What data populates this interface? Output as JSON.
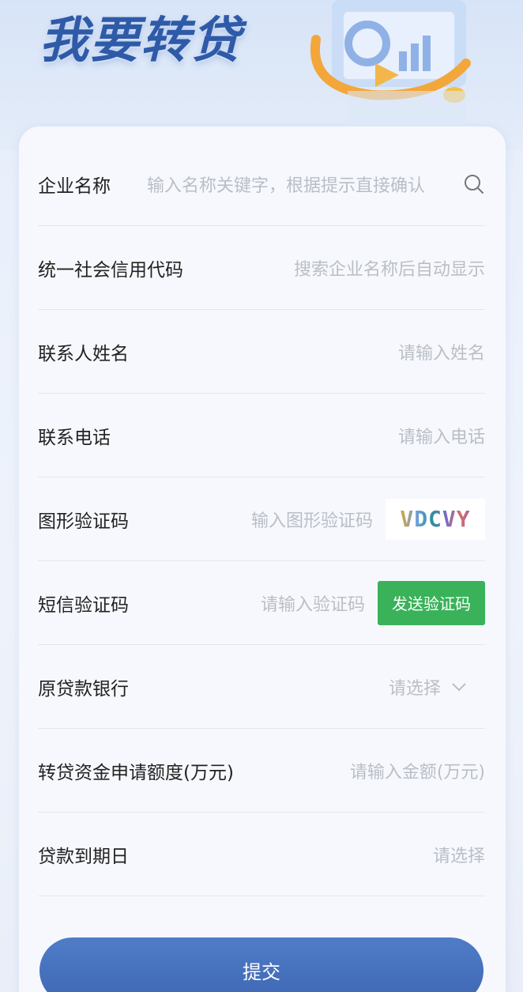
{
  "banner": {
    "title": "我要转贷"
  },
  "form": {
    "company_name": {
      "label": "企业名称",
      "placeholder": "输入名称关键字，根据提示直接确认"
    },
    "credit_code": {
      "label": "统一社会信用代码",
      "placeholder": "搜索企业名称后自动显示"
    },
    "contact_name": {
      "label": "联系人姓名",
      "placeholder": "请输入姓名"
    },
    "contact_phone": {
      "label": "联系电话",
      "placeholder": "请输入电话"
    },
    "captcha": {
      "label": "图形验证码",
      "placeholder": "输入图形验证码",
      "image_text": "VDCVY"
    },
    "sms_code": {
      "label": "短信验证码",
      "placeholder": "请输入验证码",
      "button": "发送验证码"
    },
    "original_bank": {
      "label": "原贷款银行",
      "placeholder": "请选择"
    },
    "amount": {
      "label": "转贷资金申请额度(万元)",
      "placeholder": "请输入金额(万元)"
    },
    "due_date": {
      "label": "贷款到期日",
      "placeholder": "请选择"
    }
  },
  "submit_label": "提交",
  "colors": {
    "accent": "#3f67b3",
    "sms_button": "#39b259",
    "placeholder": "#b9bec7"
  },
  "icons": {
    "search": "search-icon",
    "dropdown": "chevron-down-icon"
  }
}
